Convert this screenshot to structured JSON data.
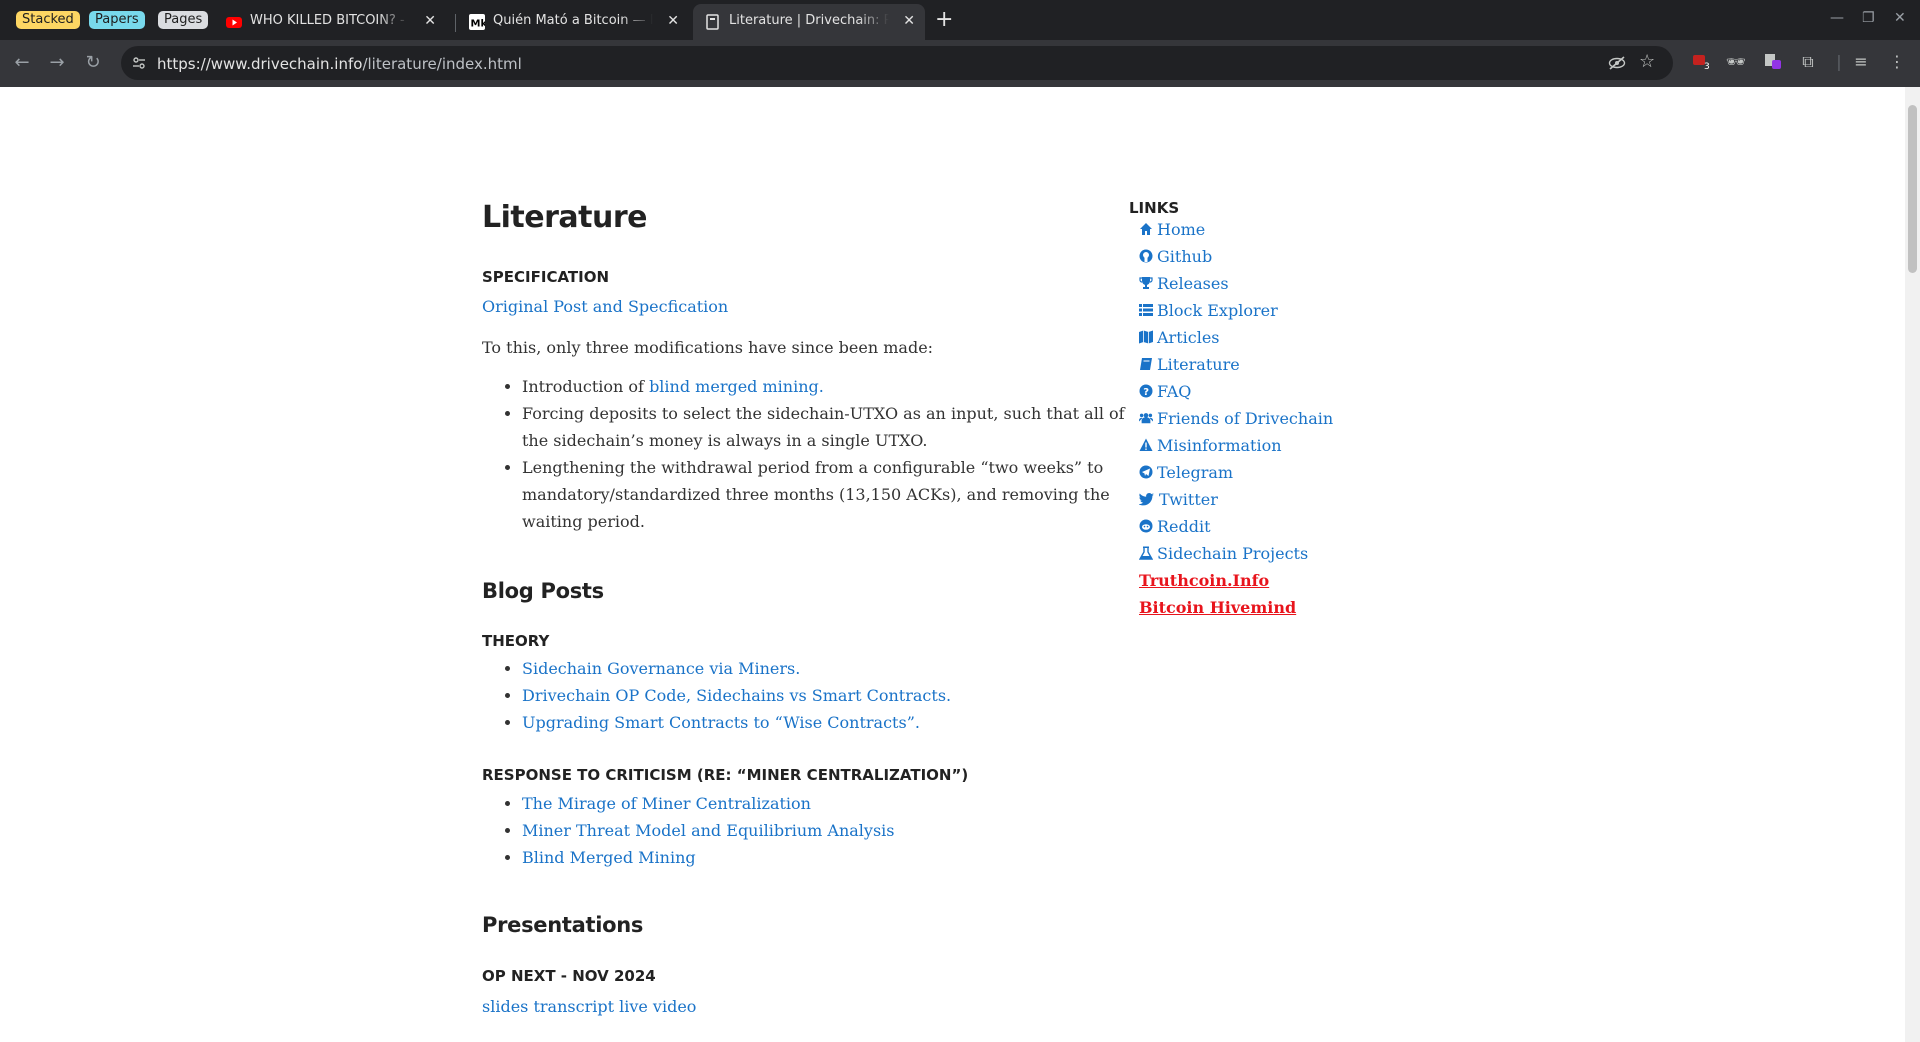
{
  "browser": {
    "tab_groups": [
      {
        "label": "Stacked",
        "color": "#fdd663"
      },
      {
        "label": "Papers",
        "color": "#78d9ec"
      },
      {
        "label": "Pages",
        "color": "#dadce0"
      }
    ],
    "tabs": [
      {
        "title": "WHO KILLED BITCOIN? - Do",
        "icon": "youtube-icon",
        "active": false
      },
      {
        "title": "Quién Mató a Bitcoin — Fur",
        "icon": "medium-icon",
        "active": false
      },
      {
        "title": "Literature | Drivechain: Pe",
        "icon": "page-icon",
        "active": true
      }
    ],
    "url_host": "https://www.drivechain.info",
    "url_path": "/literature/index.html",
    "extension_badge": "3"
  },
  "page": {
    "title": "Literature",
    "specification": {
      "heading": "SPECIFICATION",
      "link": "Original Post and Specfication",
      "intro": "To this, only three modifications have since been made:",
      "items": [
        {
          "pre": "Introduction of ",
          "link": "blind merged mining.",
          "post": ""
        },
        {
          "pre": "Forcing deposits to select the sidechain-UTXO as an input, such that all of the sidechain’s money is always in a single UTXO.",
          "link": "",
          "post": ""
        },
        {
          "pre": "Lengthening the withdrawal period from a configurable “two weeks” to mandatory/standardized three months (13,150 ACKs), and removing the waiting period.",
          "link": "",
          "post": ""
        }
      ]
    },
    "blog": {
      "heading": "Blog Posts",
      "theory_heading": "THEORY",
      "theory_links": [
        "Sidechain Governance via Miners.",
        "Drivechain OP Code, Sidechains vs Smart Contracts.",
        "Upgrading Smart Contracts to “Wise Contracts”."
      ],
      "criticism_heading": "RESPONSE TO CRITICISM (RE: “MINER CENTRALIZATION”)",
      "criticism_links": [
        "The Mirage of Miner Centralization",
        "Miner Threat Model and Equilibrium Analysis",
        "Blind Merged Mining"
      ]
    },
    "presentations": {
      "heading": "Presentations",
      "event_heading": "OP NEXT - NOV 2024",
      "links": [
        "slides",
        "transcript",
        "live video"
      ]
    },
    "sidebar": {
      "title": "LINKS",
      "items": [
        {
          "label": "Home",
          "icon": "home-icon"
        },
        {
          "label": "Github",
          "icon": "github-icon"
        },
        {
          "label": "Releases",
          "icon": "trophy-icon"
        },
        {
          "label": "Block Explorer",
          "icon": "list-icon"
        },
        {
          "label": "Articles",
          "icon": "map-icon"
        },
        {
          "label": "Literature",
          "icon": "book-icon"
        },
        {
          "label": "FAQ",
          "icon": "question-circle-icon"
        },
        {
          "label": "Friends of Drivechain",
          "icon": "users-icon"
        },
        {
          "label": "Misinformation",
          "icon": "warning-icon"
        },
        {
          "label": "Telegram",
          "icon": "telegram-icon"
        },
        {
          "label": "Twitter",
          "icon": "twitter-icon"
        },
        {
          "label": "Reddit",
          "icon": "reddit-icon"
        },
        {
          "label": "Sidechain Projects",
          "icon": "flask-icon"
        }
      ],
      "hot_links": [
        "Truthcoin.Info",
        "Bitcoin Hivemind"
      ]
    },
    "colors": {
      "link": "#1a73c8",
      "hot_link": "#e8141c",
      "heading": "#222222"
    }
  }
}
